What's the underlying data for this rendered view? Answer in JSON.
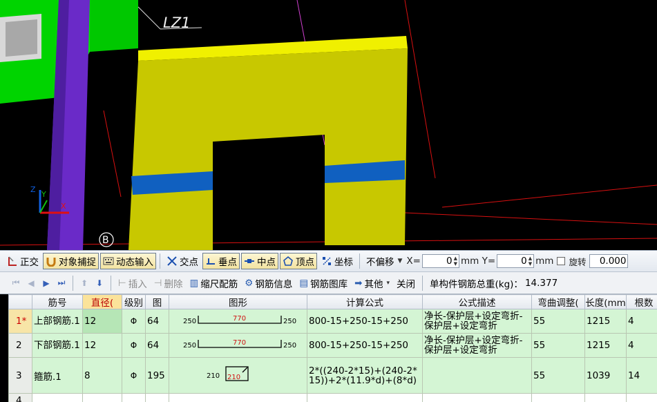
{
  "viewport": {
    "member_label": "LZ1",
    "axis_marker": "B",
    "axis_x": "X",
    "axis_y": "Y",
    "axis_z": "Z"
  },
  "snap_toolbar": {
    "ortho": "正交",
    "object_snap": "对象捕捉",
    "dynamic_input": "动态输入",
    "intersection": "交点",
    "perpendicular": "垂点",
    "midpoint": "中点",
    "vertex": "顶点",
    "coordinate": "坐标",
    "offset_mode": "不偏移",
    "x_label": "X=",
    "x_value": "0",
    "y_label": "mm Y=",
    "y_value": "0",
    "unit": "mm",
    "rotate_label": "旋转",
    "rotate_value": "0.000"
  },
  "grid_toolbar": {
    "insert": "插入",
    "delete": "删除",
    "scale_rebar": "缩尺配筋",
    "rebar_info": "钢筋信息",
    "rebar_library": "钢筋图库",
    "other": "其他",
    "close": "关闭",
    "total_weight_label": "单构件钢筋总重(kg)：",
    "total_weight_value": "14.377"
  },
  "table": {
    "headers": [
      "筋号",
      "直径(",
      "级别",
      "图",
      "图形",
      "计算公式",
      "公式描述",
      "弯曲调整(",
      "长度(mm",
      "根数"
    ],
    "rows": [
      {
        "index": "1*",
        "name": "上部钢筋.1",
        "diameter": "12",
        "grade": "Φ",
        "shape_no": "64",
        "shape_left": "250",
        "shape_mid": "770",
        "shape_right": "250",
        "formula": "800-15+250-15+250",
        "description": "净长-保护层+设定弯折-保护层+设定弯折",
        "bend_adjust": "55",
        "length": "1215",
        "count": "4"
      },
      {
        "index": "2",
        "name": "下部钢筋.1",
        "diameter": "12",
        "grade": "Φ",
        "shape_no": "64",
        "shape_left": "250",
        "shape_mid": "770",
        "shape_right": "250",
        "formula": "800-15+250-15+250",
        "description": "净长-保护层+设定弯折-保护层+设定弯折",
        "bend_adjust": "55",
        "length": "1215",
        "count": "4"
      },
      {
        "index": "3",
        "name": "箍筋.1",
        "diameter": "8",
        "grade": "Φ",
        "shape_no": "195",
        "shape_left": "210",
        "shape_mid": "210",
        "formula": "2*((240-2*15)+(240-2*15))+2*(11.9*d)+(8*d)",
        "description": "",
        "bend_adjust": "55",
        "length": "1039",
        "count": "14"
      }
    ],
    "empty_row_index": "4"
  },
  "colors": {
    "beam_yellow": "#c8c800",
    "beam_top": "#e8e800",
    "stripe_blue": "#1060c0",
    "column_green": "#00e000",
    "column_purple": "#6a2ac8",
    "row_green": "#d4f5d4"
  }
}
